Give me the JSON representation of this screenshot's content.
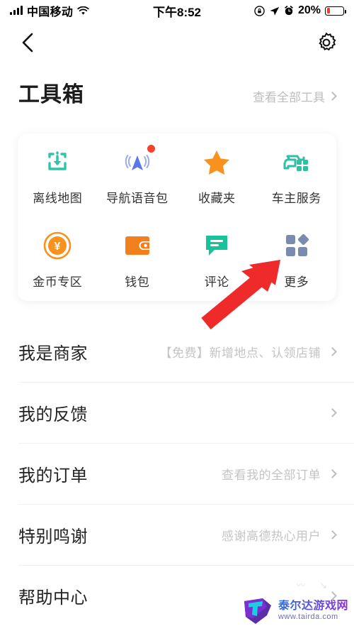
{
  "status_bar": {
    "carrier": "中国移动",
    "time": "下午8:52",
    "battery_percent": "20%",
    "battery_level": 20,
    "icons": [
      "signal-icon",
      "wifi-icon",
      "lock-rotation-icon",
      "location-arrow-icon",
      "alarm-icon",
      "battery-icon"
    ]
  },
  "nav_bar": {
    "back_icon": "back-chevron-icon",
    "settings_icon": "gear-icon"
  },
  "toolbox": {
    "title": "工具箱",
    "see_all": "查看全部工具",
    "items": [
      {
        "label": "离线地图",
        "icon": "offline-map-download-icon",
        "color": "#2ec4a6",
        "badge": false
      },
      {
        "label": "导航语音包",
        "icon": "navigation-voice-icon",
        "color": "#5b76e8",
        "badge": true
      },
      {
        "label": "收藏夹",
        "icon": "star-favorites-icon",
        "color": "#f7921e",
        "badge": false
      },
      {
        "label": "车主服务",
        "icon": "car-owner-service-icon",
        "color": "#2ebfa5",
        "badge": false
      },
      {
        "label": "金币专区",
        "icon": "gold-coin-icon",
        "color": "#f7921e",
        "badge": false
      },
      {
        "label": "钱包",
        "icon": "wallet-icon",
        "color": "#f2811d",
        "badge": false
      },
      {
        "label": "评论",
        "icon": "comment-bubble-icon",
        "color": "#17c39a",
        "badge": false
      },
      {
        "label": "更多",
        "icon": "more-grid-icon",
        "color": "#7b8bb0",
        "badge": false
      }
    ]
  },
  "menu": {
    "rows": [
      {
        "title": "我是商家",
        "sub": "【免费】新增地点、认领店铺"
      },
      {
        "title": "我的反馈",
        "sub": ""
      },
      {
        "title": "我的订单",
        "sub": "查看我的全部订单"
      },
      {
        "title": "特别鸣谢",
        "sub": "感谢高德热心用户"
      },
      {
        "title": "帮助中心",
        "sub": ""
      }
    ]
  },
  "annotation": {
    "arrow_color": "#ee2a2a",
    "points_to": "更多"
  },
  "watermark": {
    "name": "泰尔达游戏网",
    "url": "www.tairda.com"
  }
}
